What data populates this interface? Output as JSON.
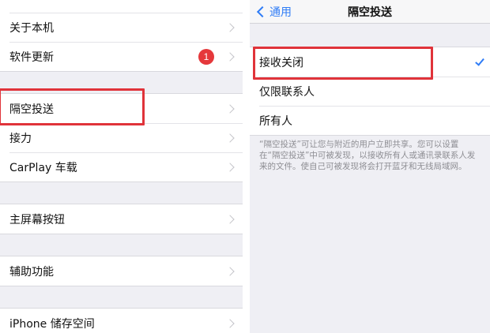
{
  "left": {
    "group1": [
      {
        "label": "关于本机"
      },
      {
        "label": "软件更新",
        "badge": "1"
      }
    ],
    "group2": [
      {
        "label": "隔空投送"
      },
      {
        "label": "接力"
      },
      {
        "label": "CarPlay 车载"
      }
    ],
    "group3": [
      {
        "label": "主屏幕按钮"
      }
    ],
    "group4": [
      {
        "label": "辅助功能"
      }
    ],
    "group5": [
      {
        "label": "iPhone 储存空间"
      }
    ]
  },
  "right": {
    "back_label": "通用",
    "title": "隔空投送",
    "options": [
      {
        "label": "接收关闭",
        "selected": true
      },
      {
        "label": "仅限联系人",
        "selected": false
      },
      {
        "label": "所有人",
        "selected": false
      }
    ],
    "footnote": "“隔空投送”可让您与附近的用户立即共享。您可以设置在“隔空投送”中可被发现，以接收所有人或通讯录联系人发来的文件。使自己可被发现将会打开蓝牙和无线局域网。"
  },
  "colors": {
    "accent": "#2f7cf6",
    "badge": "#e5383b",
    "highlight": "#e0333a"
  }
}
